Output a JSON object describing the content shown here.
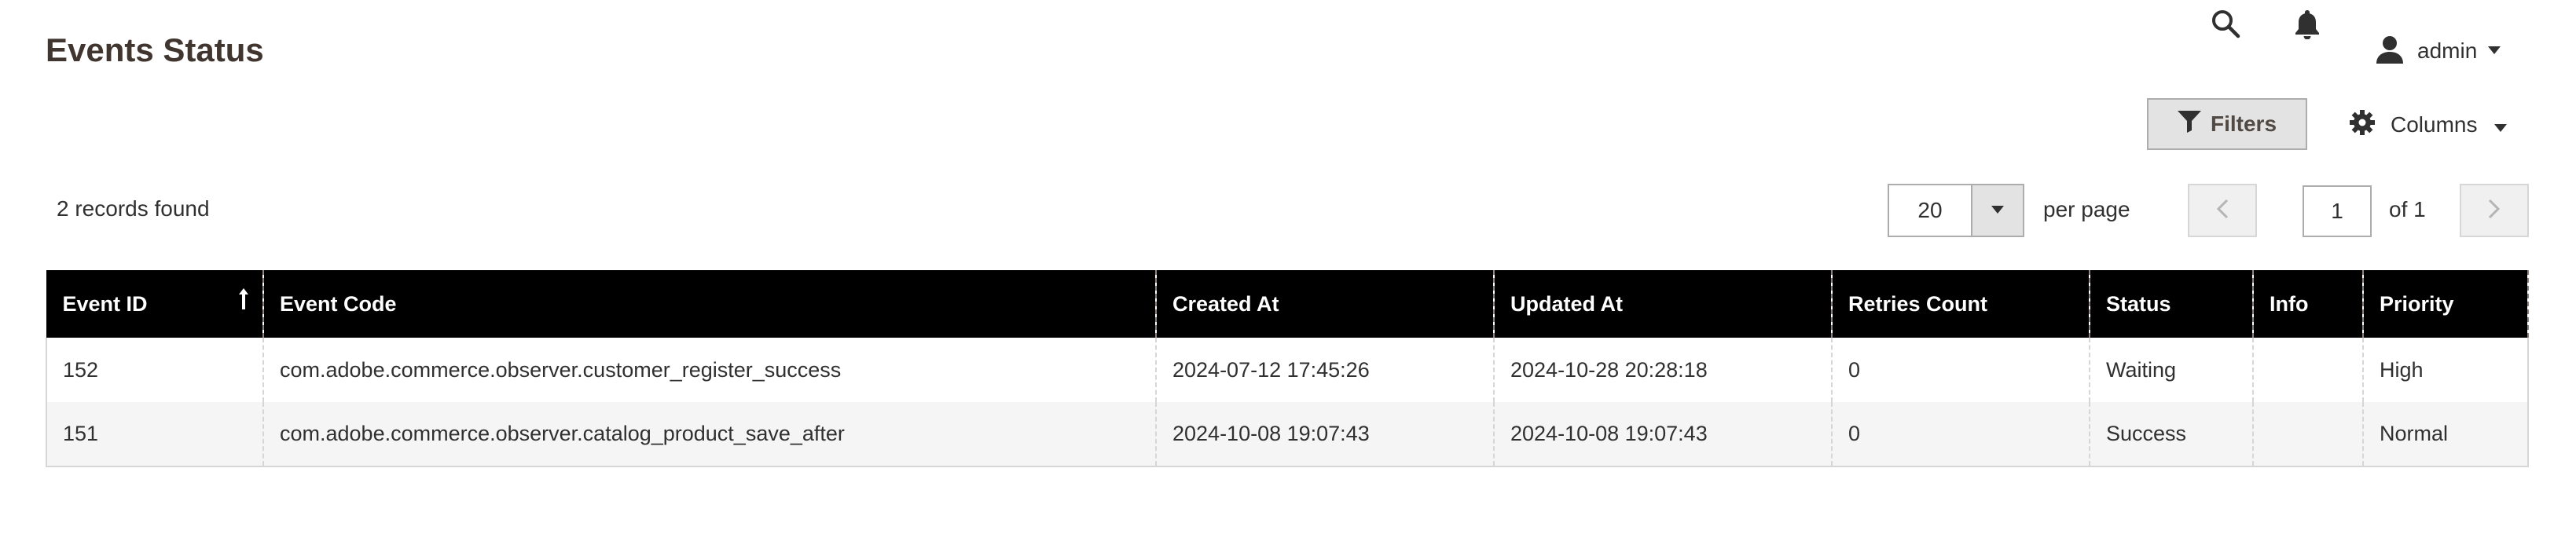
{
  "page": {
    "title": "Events Status"
  },
  "header": {
    "user_name": "admin",
    "icons": [
      "search-icon",
      "bell-icon",
      "user-icon",
      "caret-down-icon"
    ]
  },
  "toolbar": {
    "filters_label": "Filters",
    "columns_label": "Columns"
  },
  "grid": {
    "records_found": "2 records found",
    "per_page_value": "20",
    "per_page_label": "per page",
    "current_page": "1",
    "total_pages_label": "of 1",
    "columns": [
      "Event ID",
      "Event Code",
      "Created At",
      "Updated At",
      "Retries Count",
      "Status",
      "Info",
      "Priority"
    ],
    "rows": [
      {
        "event_id": "152",
        "event_code": "com.adobe.commerce.observer.customer_register_success",
        "created_at": "2024-07-12 17:45:26",
        "updated_at": "2024-10-28 20:28:18",
        "retries_count": "0",
        "status": "Waiting",
        "info": "",
        "priority": "High"
      },
      {
        "event_id": "151",
        "event_code": "com.adobe.commerce.observer.catalog_product_save_after",
        "created_at": "2024-10-08 19:07:43",
        "updated_at": "2024-10-08 19:07:43",
        "retries_count": "0",
        "status": "Success",
        "info": "",
        "priority": "Normal"
      }
    ]
  },
  "colors": {
    "header_bg": "#000000",
    "title": "#41362f",
    "text": "#303030",
    "row_alt": "#f5f5f5",
    "button_bg": "#e3e3e3"
  }
}
